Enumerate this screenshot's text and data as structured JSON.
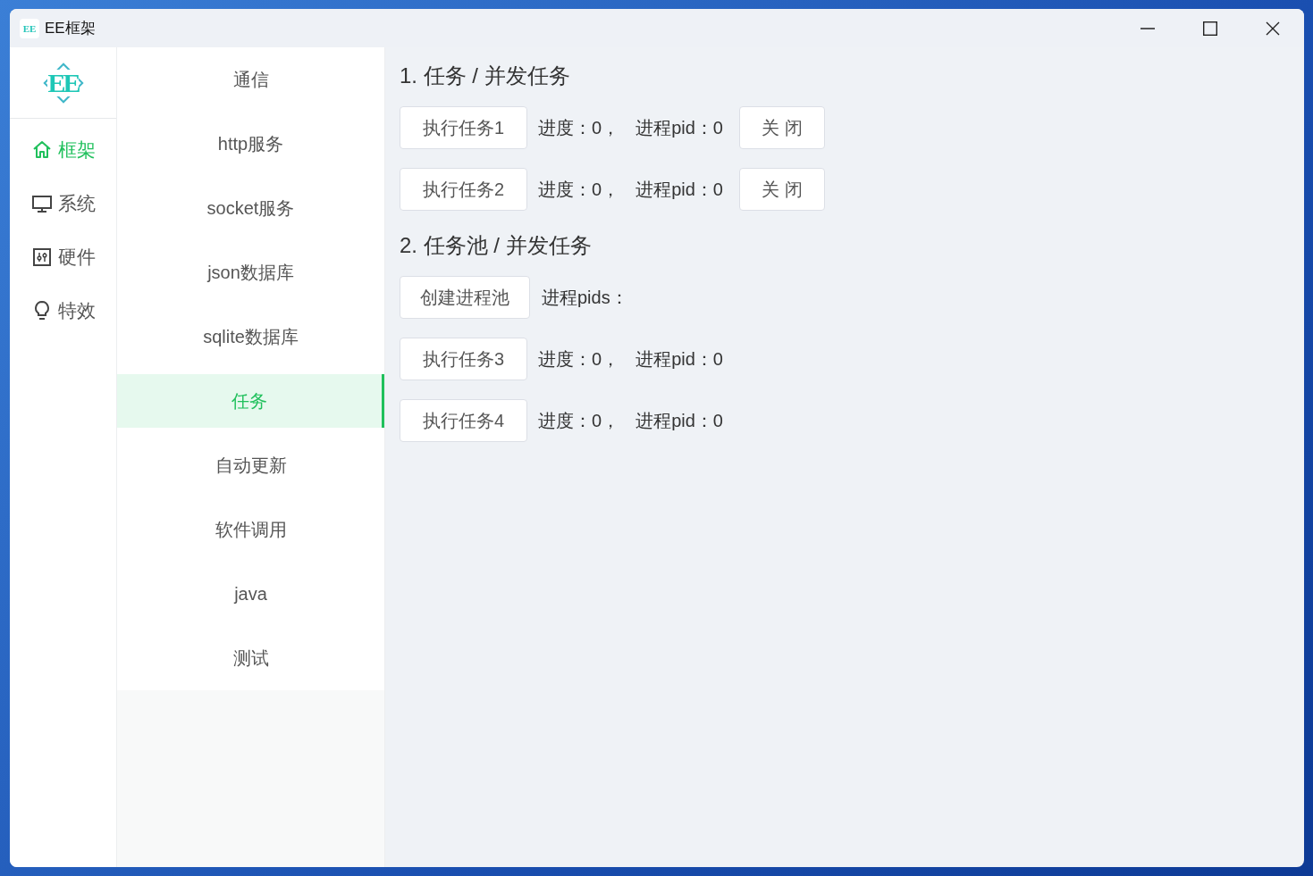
{
  "window": {
    "title": "EE框架",
    "icon_text": "EE",
    "controls": [
      {
        "kind": "minimize"
      },
      {
        "kind": "maximize"
      },
      {
        "kind": "close"
      }
    ]
  },
  "logo": {
    "text": "EE"
  },
  "rail": [
    {
      "label": "框架",
      "kind": "home",
      "selected": true
    },
    {
      "label": "系统",
      "kind": "monitor",
      "selected": false
    },
    {
      "label": "硬件",
      "kind": "sliders",
      "selected": false
    },
    {
      "label": "特效",
      "kind": "bulb",
      "selected": false
    }
  ],
  "menu": [
    {
      "label": "通信",
      "selected": false
    },
    {
      "label": "http服务",
      "selected": false
    },
    {
      "label": "socket服务",
      "selected": false
    },
    {
      "label": "json数据库",
      "selected": false
    },
    {
      "label": "sqlite数据库",
      "selected": false
    },
    {
      "label": "任务",
      "selected": true
    },
    {
      "label": "自动更新",
      "selected": false
    },
    {
      "label": "软件调用",
      "selected": false
    },
    {
      "label": "java",
      "selected": false
    },
    {
      "label": "测试",
      "selected": false
    }
  ],
  "sections": [
    {
      "title": "1. 任务 / 并发任务",
      "rows": [
        {
          "kind": "task",
          "button": "执行任务1",
          "progress": "进度：0，",
          "pid": "进程pid：0",
          "close_button": "关 闭"
        },
        {
          "kind": "task",
          "button": "执行任务2",
          "progress": "进度：0，",
          "pid": "进程pid：0",
          "close_button": "关 闭"
        }
      ]
    },
    {
      "title": "2. 任务池 / 并发任务",
      "rows": [
        {
          "kind": "pool",
          "button": "创建进程池",
          "pids": "进程pids："
        },
        {
          "kind": "task",
          "button": "执行任务3",
          "progress": "进度：0，",
          "pid": "进程pid：0"
        },
        {
          "kind": "task",
          "button": "执行任务4",
          "progress": "进度：0，",
          "pid": "进程pid：0"
        }
      ]
    }
  ]
}
